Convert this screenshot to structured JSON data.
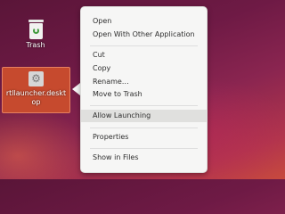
{
  "desktop": {
    "icons": [
      {
        "label": "Trash",
        "icon": "trash-icon"
      },
      {
        "label": "rtllauncher.desktop",
        "icon": "gear-icon",
        "selected": true
      }
    ]
  },
  "context_menu": {
    "highlighted_item": "Allow Launching",
    "items": [
      {
        "label": "Open"
      },
      {
        "label": "Open With Other Application"
      },
      {
        "label": "Cut"
      },
      {
        "label": "Copy"
      },
      {
        "label": "Rename…"
      },
      {
        "label": "Move to Trash"
      },
      {
        "label": "Allow Launching"
      },
      {
        "label": "Properties"
      },
      {
        "label": "Show in Files"
      }
    ]
  },
  "colors": {
    "selection_fill": "#c64a2e",
    "menu_background": "#f6f6f5",
    "menu_highlight": "#e0e0de",
    "recycle_green": "#3f9a3a"
  }
}
